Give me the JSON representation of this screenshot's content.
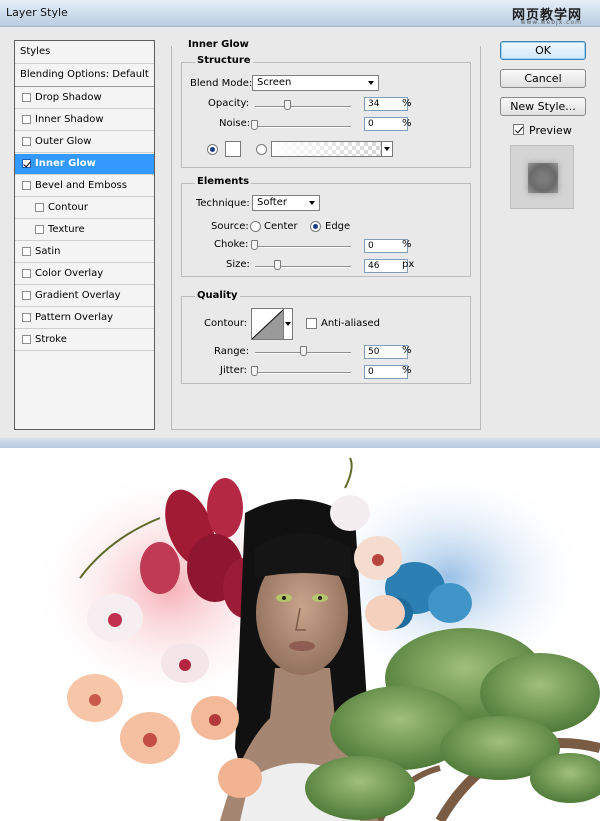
{
  "window": {
    "title": "Layer Style",
    "watermark": "网页教学网",
    "watermark_url": "www.webjx.com"
  },
  "styles_list": {
    "header": "Styles",
    "blending": "Blending Options: Default",
    "items": [
      {
        "label": "Drop Shadow",
        "checked": false
      },
      {
        "label": "Inner Shadow",
        "checked": false
      },
      {
        "label": "Outer Glow",
        "checked": false
      },
      {
        "label": "Inner Glow",
        "checked": true
      },
      {
        "label": "Bevel and Emboss",
        "checked": false
      },
      {
        "label": "Contour",
        "checked": false
      },
      {
        "label": "Texture",
        "checked": false
      },
      {
        "label": "Satin",
        "checked": false
      },
      {
        "label": "Color Overlay",
        "checked": false
      },
      {
        "label": "Gradient Overlay",
        "checked": false
      },
      {
        "label": "Pattern Overlay",
        "checked": false
      },
      {
        "label": "Stroke",
        "checked": false
      }
    ]
  },
  "panel": {
    "title": "Inner Glow",
    "structure": {
      "title": "Structure",
      "blend_mode_label": "Blend Mode:",
      "blend_mode_value": "Screen",
      "opacity_label": "Opacity:",
      "opacity_value": "34",
      "noise_label": "Noise:",
      "noise_value": "0",
      "unit": "%",
      "glow_color": "#ffffff"
    },
    "elements": {
      "title": "Elements",
      "technique_label": "Technique:",
      "technique_value": "Softer",
      "source_label": "Source:",
      "source_center": "Center",
      "source_edge": "Edge",
      "choke_label": "Choke:",
      "choke_value": "0",
      "size_label": "Size:",
      "size_value": "46",
      "pct": "%",
      "px": "px"
    },
    "quality": {
      "title": "Quality",
      "contour_label": "Contour:",
      "anti_aliased": "Anti-aliased",
      "range_label": "Range:",
      "range_value": "50",
      "jitter_label": "Jitter:",
      "jitter_value": "0",
      "unit": "%"
    }
  },
  "buttons": {
    "ok": "OK",
    "cancel": "Cancel",
    "new_style": "New Style...",
    "preview": "Preview"
  },
  "colors": {
    "selection": "#3399ff",
    "dialog_bg": "#e9e9e9"
  }
}
